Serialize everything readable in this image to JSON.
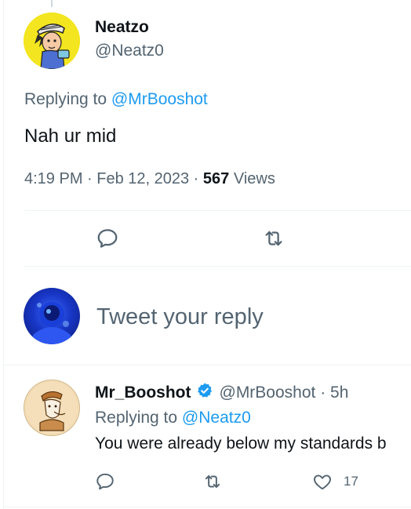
{
  "main_tweet": {
    "author": {
      "display_name": "Neatzo",
      "handle": "@Neatz0"
    },
    "replying_to_prefix": "Replying to",
    "replying_to_handle": "@MrBooshot",
    "text": "Nah ur mid",
    "timestamp": "4:19 PM · Feb 12, 2023 · ",
    "views_count": "567",
    "views_label": " Views",
    "actions": {
      "reply_icon": "reply-icon",
      "retweet_icon": "retweet-icon"
    }
  },
  "compose": {
    "placeholder": "Tweet your reply"
  },
  "reply_tweet": {
    "author": {
      "display_name": "Mr_Booshot",
      "handle_and_time": "@MrBooshot · 5h",
      "verified": true
    },
    "replying_to_prefix": "Replying to",
    "replying_to_handle": "@Neatz0",
    "text": "You were already below my standards b",
    "actions": {
      "like_count": "17"
    }
  },
  "colors": {
    "link": "#1d9bf0",
    "secondary_text": "#536471",
    "primary_text": "#0f1419",
    "divider": "#eff3f4",
    "verified": "#1d9bf0"
  }
}
